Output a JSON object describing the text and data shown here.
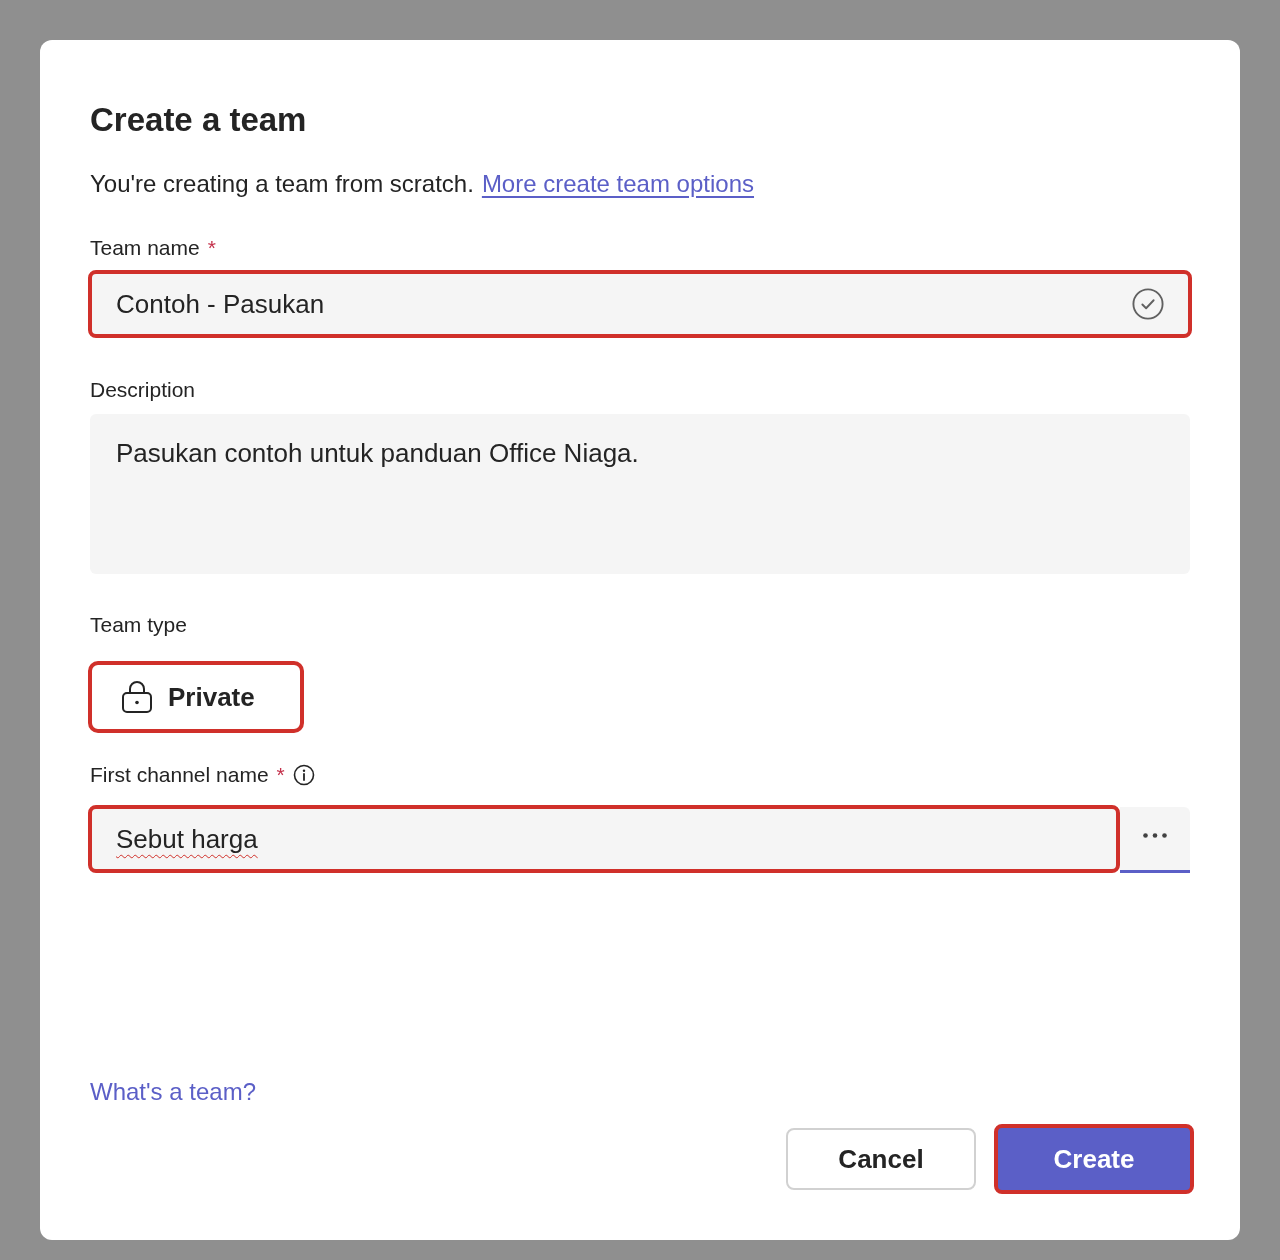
{
  "dialog": {
    "title": "Create a team",
    "subtitle": {
      "text": "You're creating a team from scratch.",
      "link": "More create team options"
    },
    "fields": [
      {
        "kind": "text",
        "label": "Team name",
        "required_mark": "*",
        "value": "Contoh - Pasukan",
        "valid": true,
        "highlighted": true
      },
      {
        "kind": "textarea",
        "label": "Description",
        "value": "Pasukan contoh untuk panduan Office Niaga.",
        "highlighted": false
      },
      {
        "kind": "choice",
        "label": "Team type",
        "value": "Private",
        "highlighted": true
      },
      {
        "kind": "text_more",
        "label": "First channel name",
        "required_mark": "*",
        "info": true,
        "value": "Sebut harga",
        "misspelled": true,
        "focused": true,
        "highlighted": true
      }
    ],
    "help_link": "What's a team?",
    "buttons": [
      {
        "label": "Cancel",
        "kind": "secondary",
        "highlighted": false
      },
      {
        "label": "Create",
        "kind": "primary",
        "highlighted": true
      }
    ]
  }
}
